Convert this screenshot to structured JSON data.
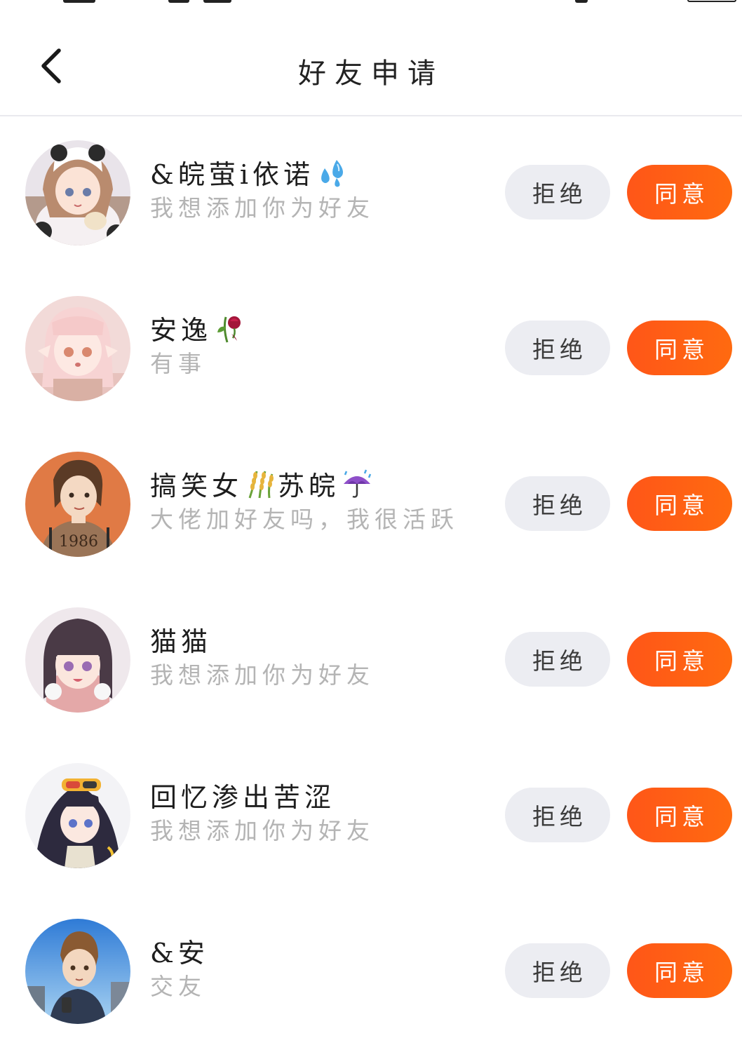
{
  "header": {
    "title": "好友申请",
    "back_icon": "chevron-left-icon"
  },
  "actions": {
    "reject_label": "拒绝",
    "accept_label": "同意"
  },
  "colors": {
    "accent": "#ff5a16",
    "reject_bg": "#ecedf2",
    "message_text": "#b4b4b4",
    "name_text": "#1e1e1e"
  },
  "requests": [
    {
      "name": "&皖萤i依诺",
      "emoji": "sweat-droplets",
      "message": "我想添加你为好友",
      "avatar": "anime-girl-panda-hood"
    },
    {
      "name": "安逸",
      "emoji": "wilted-rose",
      "message": "有事",
      "avatar": "anime-girl-pink-hair"
    },
    {
      "name": "搞笑女",
      "emoji": "rice-sheaf",
      "name_suffix": "苏皖",
      "emoji2": "umbrella-rain",
      "message": "大佬加好友吗，我很活跃",
      "avatar": "girl-1986-shirt"
    },
    {
      "name": "猫猫",
      "emoji": "",
      "message": "我想添加你为好友",
      "avatar": "anime-girl-dark-bangs"
    },
    {
      "name": "回忆渗出苦涩",
      "emoji": "",
      "message": "我想添加你为好友",
      "avatar": "anime-girl-goggles"
    },
    {
      "name": "&安",
      "emoji": "",
      "message": "交友",
      "avatar": "anime-boy-phone"
    }
  ]
}
